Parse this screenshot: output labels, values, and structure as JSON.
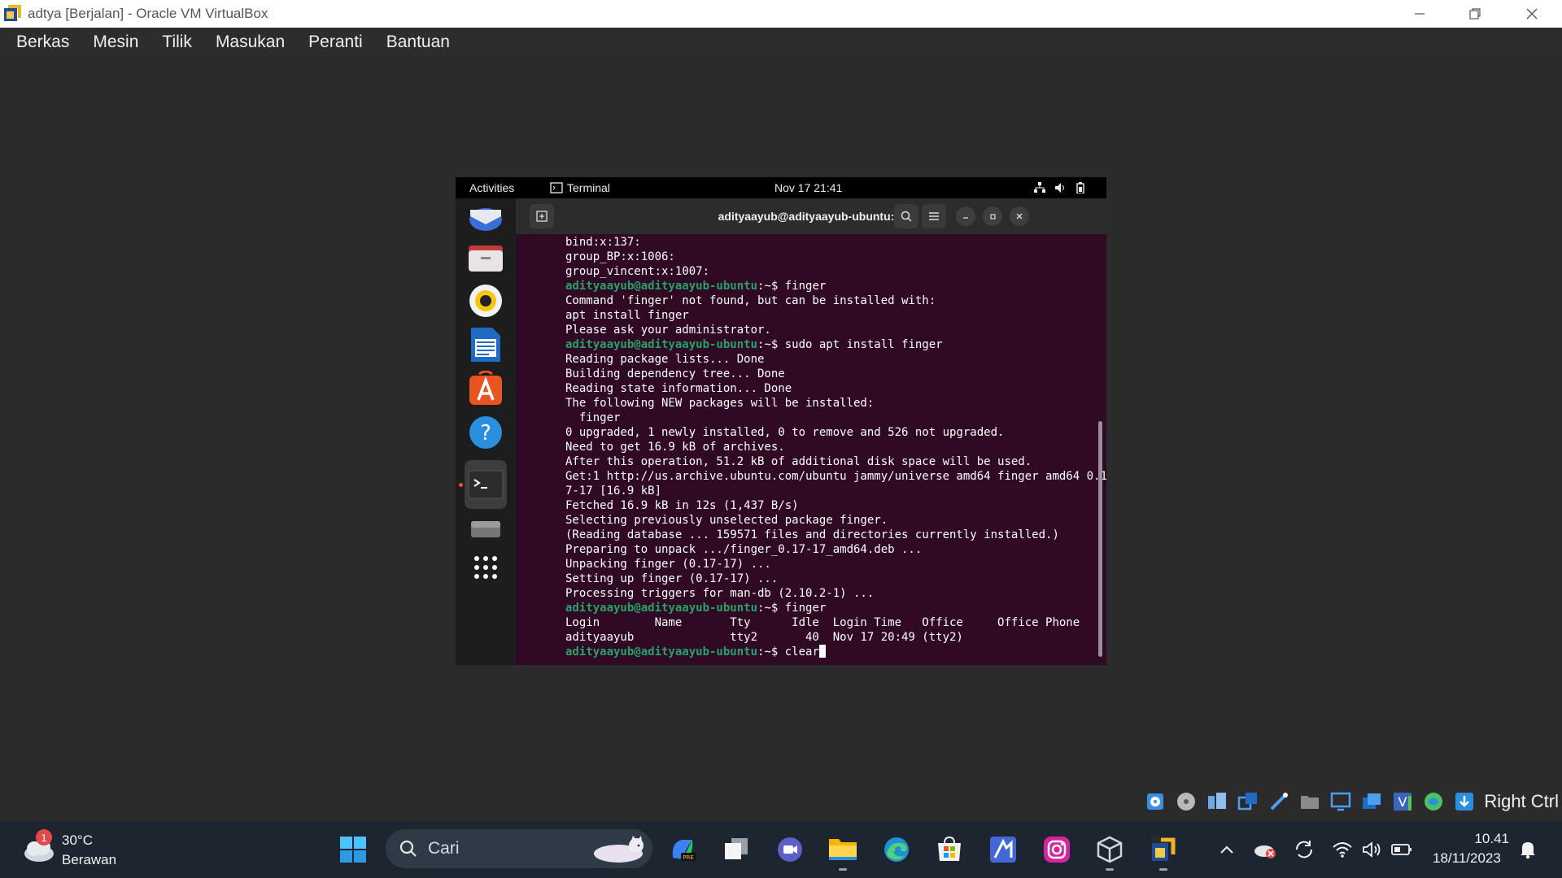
{
  "window": {
    "title": "adtya [Berjalan] - Oracle VM VirtualBox"
  },
  "menubar": [
    "Berkas",
    "Mesin",
    "Tilik",
    "Masukan",
    "Peranti",
    "Bantuan"
  ],
  "gnome": {
    "activities": "Activities",
    "app_name": "Terminal",
    "clock": "Nov 17  21:41"
  },
  "terminal": {
    "title": "adityaayub@adityaayub-ubuntu: ~",
    "lines": [
      {
        "text": "bind:x:137:"
      },
      {
        "text": "group_BP:x:1006:"
      },
      {
        "text": "group_vincent:x:1007:"
      },
      {
        "prompt": "adityaayub@adityaayub-ubuntu",
        "sym": ":~$ ",
        "text": "finger"
      },
      {
        "text": "Command 'finger' not found, but can be installed with:"
      },
      {
        "text": "apt install finger"
      },
      {
        "text": "Please ask your administrator."
      },
      {
        "prompt": "adityaayub@adityaayub-ubuntu",
        "sym": ":~$ ",
        "text": "sudo apt install finger"
      },
      {
        "text": "Reading package lists... Done"
      },
      {
        "text": "Building dependency tree... Done"
      },
      {
        "text": "Reading state information... Done"
      },
      {
        "text": "The following NEW packages will be installed:"
      },
      {
        "text": "  finger"
      },
      {
        "text": "0 upgraded, 1 newly installed, 0 to remove and 526 not upgraded."
      },
      {
        "text": "Need to get 16.9 kB of archives."
      },
      {
        "text": "After this operation, 51.2 kB of additional disk space will be used."
      },
      {
        "text": "Get:1 http://us.archive.ubuntu.com/ubuntu jammy/universe amd64 finger amd64 0.1"
      },
      {
        "text": "7-17 [16.9 kB]"
      },
      {
        "text": "Fetched 16.9 kB in 12s (1,437 B/s)"
      },
      {
        "text": "Selecting previously unselected package finger."
      },
      {
        "text": "(Reading database ... 159571 files and directories currently installed.)"
      },
      {
        "text": "Preparing to unpack .../finger_0.17-17_amd64.deb ..."
      },
      {
        "text": "Unpacking finger (0.17-17) ..."
      },
      {
        "text": "Setting up finger (0.17-17) ..."
      },
      {
        "text": "Processing triggers for man-db (2.10.2-1) ..."
      },
      {
        "prompt": "adityaayub@adityaayub-ubuntu",
        "sym": ":~$ ",
        "text": "finger"
      },
      {
        "text": "Login        Name       Tty      Idle  Login Time   Office     Office Phone"
      },
      {
        "text": "adityaayub              tty2       40  Nov 17 20:49 (tty2)"
      }
    ],
    "current_prompt": "adityaayub@adityaayub-ubuntu",
    "current_sym": ":~$ ",
    "current_input": "clear"
  },
  "statusbar": {
    "host_key": "Right Ctrl"
  },
  "taskbar": {
    "weather_temp": "30°C",
    "weather_desc": "Berawan",
    "weather_badge": "1",
    "search_placeholder": "Cari",
    "time": "10.41",
    "date": "18/11/2023"
  }
}
